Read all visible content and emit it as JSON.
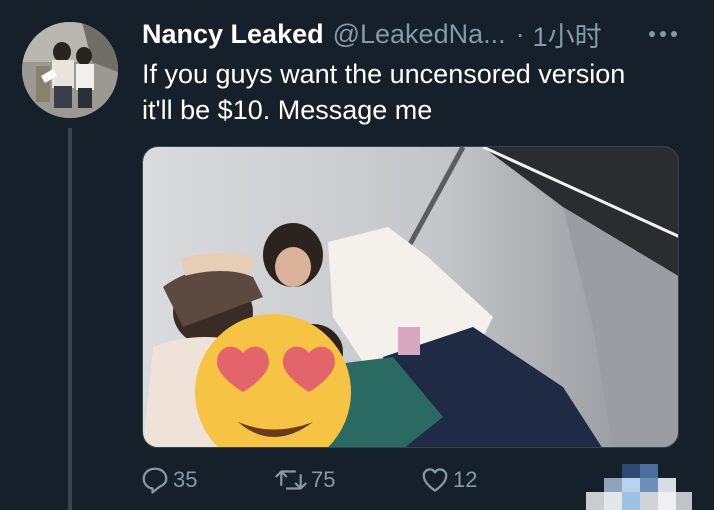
{
  "tweet": {
    "display_name": "Nancy Leaked",
    "handle": "@LeakedNa...",
    "separator": "·",
    "timestamp": "1小时",
    "text_line1": "If you guys want the uncensored version",
    "text_line2": "it'll be $10. Message me"
  },
  "actions": {
    "reply_count": "35",
    "retweet_count": "75",
    "like_count": "12"
  },
  "icons": {
    "reply": "reply-icon",
    "retweet": "retweet-icon",
    "like": "heart-icon",
    "more": "more-options-icon",
    "censor": "heart-eyes-emoji"
  },
  "colors": {
    "background": "#15202b",
    "text": "#ffffff",
    "secondary_text": "#8899a6",
    "thread_line": "#38444d"
  }
}
